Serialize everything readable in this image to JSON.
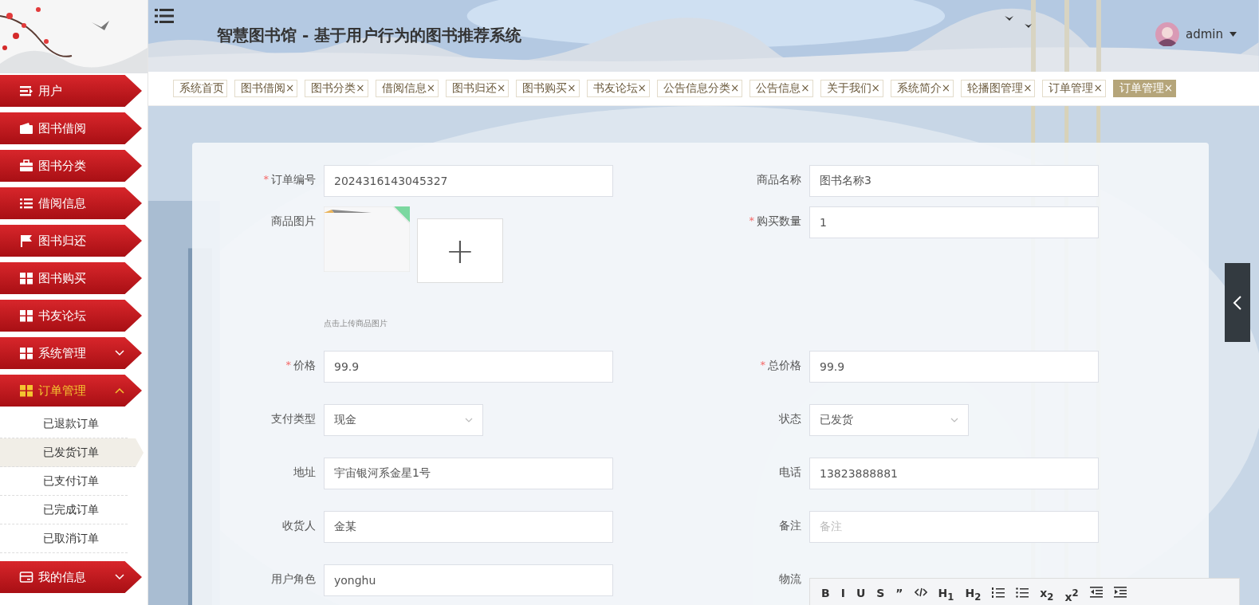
{
  "header": {
    "title": "智慧图书馆 - 基于用户行为的图书推荐系统",
    "user": "admin"
  },
  "sidebar": {
    "items": [
      {
        "label": "用户",
        "selected": false
      },
      {
        "label": "图书借阅",
        "selected": false
      },
      {
        "label": "图书分类",
        "selected": false
      },
      {
        "label": "借阅信息",
        "selected": false
      },
      {
        "label": "图书归还",
        "selected": false
      },
      {
        "label": "图书购买",
        "selected": false
      },
      {
        "label": "书友论坛",
        "selected": false
      },
      {
        "label": "系统管理",
        "selected": false,
        "expanded": false
      },
      {
        "label": "订单管理",
        "selected": true,
        "expanded": true,
        "children": [
          {
            "label": "已退款订单",
            "selected": false
          },
          {
            "label": "已发货订单",
            "selected": true
          },
          {
            "label": "已支付订单",
            "selected": false
          },
          {
            "label": "已完成订单",
            "selected": false
          },
          {
            "label": "已取消订单",
            "selected": false
          }
        ]
      },
      {
        "label": "我的信息",
        "selected": false,
        "expanded": false
      }
    ]
  },
  "tabs": [
    {
      "label": "系统首页",
      "selected": false
    },
    {
      "label": "图书借阅",
      "close": "×",
      "selected": false
    },
    {
      "label": "图书分类",
      "close": "×",
      "selected": false
    },
    {
      "label": "借阅信息",
      "close": "×",
      "selected": false
    },
    {
      "label": "图书归还",
      "close": "×",
      "selected": false
    },
    {
      "label": "图书购买",
      "close": "×",
      "selected": false
    },
    {
      "label": "书友论坛",
      "close": "×",
      "selected": false
    },
    {
      "label": "公告信息分类",
      "close": "×",
      "selected": false
    },
    {
      "label": "公告信息",
      "close": "×",
      "selected": false
    },
    {
      "label": "关于我们",
      "close": "×",
      "selected": false
    },
    {
      "label": "系统简介",
      "close": "×",
      "selected": false
    },
    {
      "label": "轮播图管理",
      "close": "×",
      "selected": false
    },
    {
      "label": "订单管理",
      "close": "×",
      "selected": false
    },
    {
      "label": "订单管理",
      "close": "×",
      "selected": true
    }
  ],
  "form": {
    "rows": [
      [
        {
          "kind": "text",
          "label": "订单编号",
          "required_mark": "*",
          "value": "2024316143045327"
        },
        {
          "kind": "text",
          "label": "商品名称",
          "value": "图书名称3"
        }
      ],
      [
        {
          "label": "商品图片",
          "hint": "点击上传商品图片",
          "upload": "+"
        },
        {
          "kind": "text",
          "label": "购买数量",
          "required_mark": "*",
          "value": "1"
        }
      ],
      [
        {
          "kind": "text",
          "label": "价格",
          "required_mark": "*",
          "value": "99.9"
        },
        {
          "kind": "text",
          "label": "总价格",
          "required_mark": "*",
          "value": "99.9"
        }
      ],
      [
        {
          "kind": "select",
          "label": "支付类型",
          "value": "现金"
        },
        {
          "kind": "select",
          "label": "状态",
          "value": "已发货"
        }
      ],
      [
        {
          "kind": "text",
          "label": "地址",
          "value": "宇宙银河系金星1号"
        },
        {
          "kind": "text",
          "label": "电话",
          "value": "13823888881"
        }
      ],
      [
        {
          "kind": "text",
          "label": "收货人",
          "value": "金某"
        },
        {
          "kind": "text",
          "label": "备注",
          "placeholder": "备注"
        }
      ],
      [
        {
          "kind": "text",
          "label": "用户角色",
          "value": "yonghu"
        },
        {
          "kind": "editor",
          "label": "物流",
          "tools": [
            {
              "kind": "text",
              "label": "B"
            },
            {
              "kind": "text",
              "label": "I"
            },
            {
              "kind": "text",
              "label": "U"
            },
            {
              "kind": "text",
              "label": "S"
            },
            {
              "kind": "text",
              "label": "”"
            },
            {
              "kind": "code"
            },
            {
              "kind": "text",
              "label": "H$_{1}$"
            },
            {
              "kind": "text",
              "label": "H$_{2}$"
            },
            {
              "kind": "ordered-list"
            },
            {
              "kind": "bullet-list"
            },
            {
              "kind": "text",
              "label": "x$_{2}$"
            },
            {
              "kind": "text",
              "label": "x$^{2}$"
            },
            {
              "kind": "outdent"
            },
            {
              "kind": "indent"
            }
          ]
        }
      ]
    ]
  }
}
